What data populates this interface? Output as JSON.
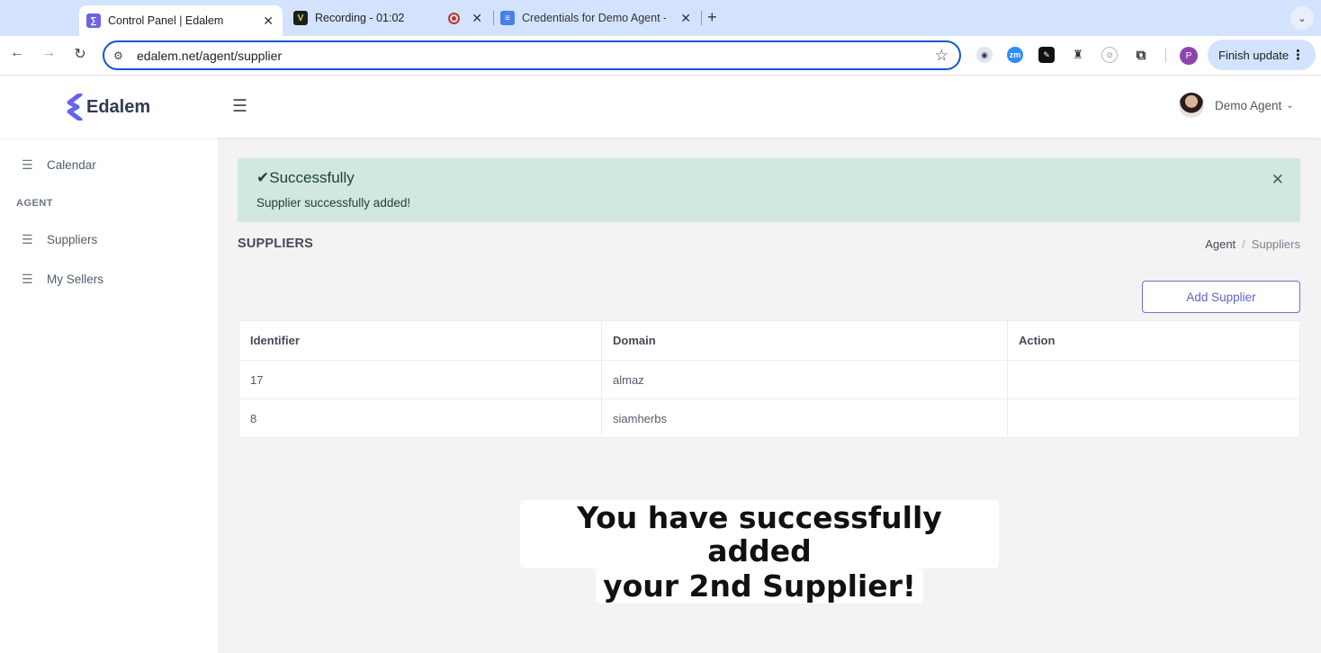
{
  "browser": {
    "tabs": [
      {
        "title": "Control Panel | Edalem",
        "favicon": "edalem-logo-icon",
        "active": true
      },
      {
        "title": "Recording - 01:02",
        "favicon": "vimeo-record-icon",
        "active": false
      },
      {
        "title": "Credentials for Demo Agent -",
        "favicon": "google-docs-icon",
        "active": false
      }
    ],
    "url": "edalem.net/agent/supplier",
    "finish_update_label": "Finish update",
    "profile_initial": "P",
    "colors": {
      "omnibox_border": "#0b57d0",
      "tabbar_bg": "#d3e3fd"
    }
  },
  "header": {
    "brand": "Edalem",
    "user_name": "Demo Agent"
  },
  "sidebar": {
    "items_top": [
      {
        "label": "Calendar",
        "icon": "list-icon"
      }
    ],
    "section_heading": "AGENT",
    "items": [
      {
        "label": "Suppliers",
        "icon": "list-icon"
      },
      {
        "label": "My Sellers",
        "icon": "list-icon"
      }
    ]
  },
  "alert": {
    "title": "Successfully",
    "message": "Supplier successfully added!",
    "color": "#d0e8dd"
  },
  "page": {
    "title": "SUPPLIERS",
    "breadcrumb": {
      "parent": "Agent",
      "separator": "/",
      "current": "Suppliers"
    },
    "add_button": "Add Supplier"
  },
  "table": {
    "columns": [
      "Identifier",
      "Domain",
      "Action"
    ],
    "rows": [
      {
        "identifier": "17",
        "domain": "almaz",
        "action": ""
      },
      {
        "identifier": "8",
        "domain": "siamherbs",
        "action": ""
      }
    ]
  },
  "caption": {
    "line1": "You have successfully added",
    "line2": "your 2nd Supplier!"
  }
}
